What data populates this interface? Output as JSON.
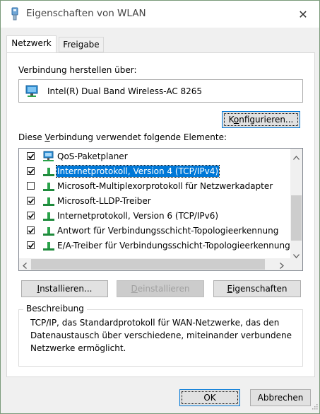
{
  "window": {
    "title": "Eigenschaften von WLAN"
  },
  "tabs": [
    {
      "label": "Netzwerk",
      "active": true
    },
    {
      "label": "Freigabe",
      "active": false
    }
  ],
  "connect_via": {
    "label": "Verbindung herstellen über:",
    "adapter": "Intel(R) Dual Band Wireless-AC 8265",
    "configure_button_pre": "K",
    "configure_button_u": "o",
    "configure_button_post": "nfigurieren..."
  },
  "elements": {
    "label_pre": "Diese ",
    "label_u": "V",
    "label_post": "erbindung verwendet folgende Elemente:",
    "items": [
      {
        "label": "QoS-Paketplaner",
        "checked": true,
        "icon": "network-service-icon",
        "selected": false
      },
      {
        "label": "Internetprotokoll, Version 4 (TCP/IPv4)",
        "checked": true,
        "icon": "protocol-icon",
        "selected": true
      },
      {
        "label": "Microsoft-Multiplexorprotokoll für Netzwerkadapter",
        "checked": false,
        "icon": "protocol-icon",
        "selected": false
      },
      {
        "label": "Microsoft-LLDP-Treiber",
        "checked": true,
        "icon": "protocol-icon",
        "selected": false
      },
      {
        "label": "Internetprotokoll, Version 6 (TCP/IPv6)",
        "checked": true,
        "icon": "protocol-icon",
        "selected": false
      },
      {
        "label": "Antwort für Verbindungsschicht-Topologieerkennung",
        "checked": true,
        "icon": "protocol-icon",
        "selected": false
      },
      {
        "label": "E/A-Treiber für Verbindungsschicht-Topologieerkennung",
        "checked": true,
        "icon": "protocol-icon",
        "selected": false
      }
    ]
  },
  "buttons": {
    "install_u": "I",
    "install_post": "nstallieren...",
    "uninstall_u": "D",
    "uninstall_post": "einstallieren",
    "properties_u": "E",
    "properties_post": "igenschaften",
    "ok": "OK",
    "cancel": "Abbrechen"
  },
  "description": {
    "title": "Beschreibung",
    "text": "TCP/IP, das Standardprotokoll für WAN-Netzwerke, das den Datenaustausch über verschiedene, miteinander verbundene Netzwerke ermöglicht."
  },
  "colors": {
    "selection": "#0078d7",
    "focus_border": "#0078d7"
  }
}
